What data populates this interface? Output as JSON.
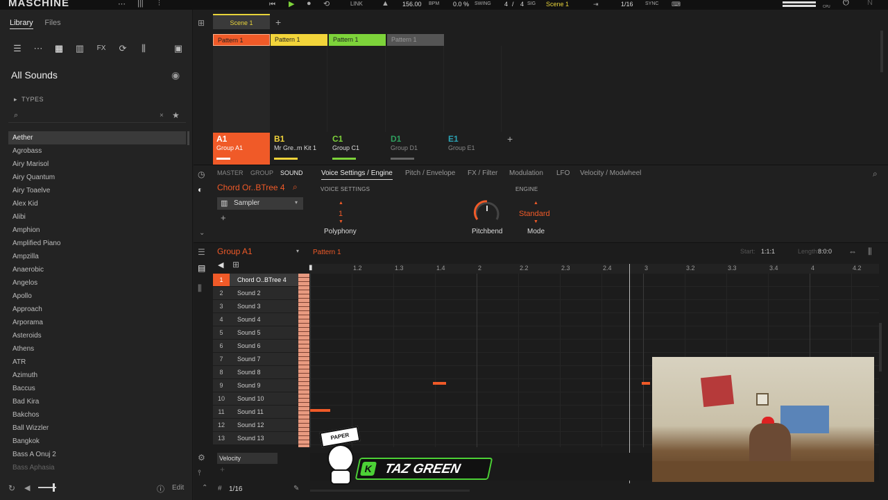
{
  "topbar": {
    "logo": "MASCHINE",
    "link": "LINK",
    "bpm": "156.00",
    "bpm_unit": "BPM",
    "swing": "0.0 %",
    "swing_label": "SWING",
    "sig_num": "4",
    "sig_slash": "/",
    "sig_den": "4",
    "sig_label": "SIG",
    "scene": "Scene 1",
    "quant": "1/16",
    "sync": "SYNC",
    "cpu": "CPU"
  },
  "library": {
    "tab_library": "Library",
    "tab_files": "Files",
    "title": "All Sounds",
    "types": "TYPES",
    "items": [
      "Aether",
      "Agrobass",
      "Airy Marisol",
      "Airy Quantum",
      "Airy Toaelve",
      "Alex Kid",
      "Alibi",
      "Amphion",
      "Amplified Piano",
      "Ampzilla",
      "Anaerobic",
      "Angelos",
      "Apollo",
      "Approach",
      "Arporama",
      "Asteroids",
      "Athens",
      "ATR",
      "Azimuth",
      "Baccus",
      "Bad Kira",
      "Bakchos",
      "Ball Wizzler",
      "Bangkok",
      "Bass A Onuj 2",
      "Bass Aphasia"
    ],
    "edit": "Edit"
  },
  "arranger": {
    "scene": "Scene 1",
    "patterns": [
      "Pattern 1",
      "Pattern 1",
      "Pattern 1",
      "Pattern 1"
    ],
    "groups": [
      {
        "letter": "A1",
        "name": "Group A1",
        "color": "#f05a28"
      },
      {
        "letter": "B1",
        "name": "Mr Gre..m Kit 1",
        "color": "#f2d43a"
      },
      {
        "letter": "C1",
        "name": "Group C1",
        "color": "#7dd33a"
      },
      {
        "letter": "D1",
        "name": "Group D1",
        "color": "#2e9e5e"
      },
      {
        "letter": "E1",
        "name": "Group E1",
        "color": "#2ba3b5"
      }
    ]
  },
  "params": {
    "tab_master": "MASTER",
    "tab_group": "GROUP",
    "tab_sound": "SOUND",
    "sound_name": "Chord Or..BTree 4",
    "plugin": "Sampler",
    "tabs": [
      "Voice Settings / Engine",
      "Pitch / Envelope",
      "FX / Filter",
      "Modulation",
      "LFO",
      "Velocity / Modwheel"
    ],
    "voice_settings": "VOICE SETTINGS",
    "engine": "ENGINE",
    "polyphony_value": "1",
    "polyphony": "Polyphony",
    "pitchbend": "Pitchbend",
    "mode_value": "Standard",
    "mode": "Mode"
  },
  "editor": {
    "group": "Group A1",
    "pattern": "Pattern 1",
    "start_label": "Start:",
    "start": "1:1:1",
    "length_label": "Length:",
    "length": "8:0:0",
    "sounds": [
      "Chord O..BTree 4",
      "Sound 2",
      "Sound 3",
      "Sound 4",
      "Sound 5",
      "Sound 6",
      "Sound 7",
      "Sound 8",
      "Sound 9",
      "Sound 10",
      "Sound 11",
      "Sound 12",
      "Sound 13"
    ],
    "nums": [
      "1",
      "2",
      "3",
      "4",
      "5",
      "6",
      "7",
      "8",
      "9",
      "10",
      "11",
      "12",
      "13"
    ],
    "ruler": [
      "1.2",
      "1.3",
      "1.4",
      "2",
      "2.2",
      "2.3",
      "2.4",
      "3",
      "3.2",
      "3.3",
      "3.4",
      "4",
      "4.2"
    ],
    "velocity": "Velocity",
    "grid": "1/16",
    "overlay_brand": "TAZ GREEN",
    "overlay_badge": "PAPER ROUTE"
  },
  "colors": {
    "accent": "#f05a28"
  }
}
